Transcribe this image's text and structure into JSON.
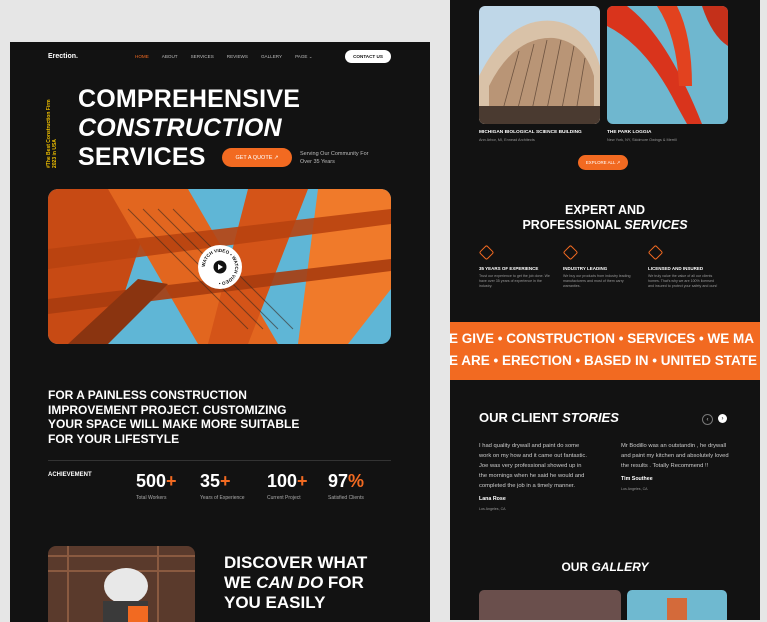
{
  "left": {
    "logo": "Erection.",
    "nav": [
      "HOME",
      "ABOUT",
      "SERVICES",
      "REVIEWS",
      "GALLERY",
      "PAGE ⌄"
    ],
    "contact": "CONTACT US",
    "vertical": "#The Best Construction Firm 2023 in USA",
    "hero": {
      "line1": "COMPREHENSIVE",
      "line2": "CONSTRUCTION",
      "line3": "SERVICES"
    },
    "quote_btn": "GET A QUOTE ↗",
    "serving": "Serving Our Community For Over 35 Years",
    "watch_video": "WATCH VIDEO • WATCH VIDEO •",
    "paragraph": "FOR A PAINLESS CONSTRUCTION IMPROVEMENT PROJECT. CUSTOMIZING YOUR SPACE WILL MAKE MORE SUITABLE FOR YOUR LIFESTYLE",
    "achievement": "ACHIEVEMENT",
    "stats": [
      {
        "num": "500",
        "plus": "+",
        "label": "Total Workers"
      },
      {
        "num": "35",
        "plus": "+",
        "label": "Years of Experience"
      },
      {
        "num": "100",
        "plus": "+",
        "label": "Current Project"
      },
      {
        "num": "97",
        "plus": "%",
        "label": "Satisfied Clients"
      }
    ],
    "discover": {
      "a": "DISCOVER WHAT",
      "b": "WE ",
      "c": "CAN DO",
      "d": " FOR",
      "e": "YOU EASILY"
    }
  },
  "right": {
    "projects": [
      {
        "title": "MICHIGAN BIOLOGICAL SCIENCE BUILDING",
        "sub": "Ann Arbor, MI, Ennead Architects"
      },
      {
        "title": "THE PARK LOGGIA",
        "sub": "New York, NY, Skidmore Owings & Merrill"
      }
    ],
    "explore": "EXPLORE ALL ↗",
    "expert": {
      "l1": "EXPERT AND",
      "l2": "PROFESSIONAL ",
      "l2i": "SERVICES"
    },
    "features": [
      {
        "title": "35 YEARS OF EXPERIENCE",
        "desc": "Trust our experience to get the job done. We have over 35 years of experience in the industry."
      },
      {
        "title": "INDUSTRY LEADING",
        "desc": "We buy our products from industry leading manufacturers and most of them carry warranties."
      },
      {
        "title": "LICENSED AND INSURED",
        "desc": "We truly value the value of all our clients homes. That's why we are 100% licensed and insured to protect your safety and ours!"
      }
    ],
    "band1": "E GIVE • CONSTRUCTION • SERVICES • WE MA",
    "band2": "E ARE • ERECTION • BASED IN • UNITED STATE",
    "stories": {
      "a": "OUR CLIENT ",
      "b": "STORIES"
    },
    "reviews": [
      {
        "text": "I had quality drywall and paint do some work on my how and it came out fantastic. Joe was very professional showed up in the mornings when he said he would and completed the job in a timely manner.",
        "name": "Lana Rose",
        "loc": "Los Angeles, CA"
      },
      {
        "text": "Mr Bodillo was an outstandin , he drywall and paint my kitchen and absolutely loved the results . Totally Recommend !!",
        "name": "Tim Southee",
        "loc": "Los Angeles, CA"
      }
    ],
    "gallery": {
      "a": "OUR ",
      "b": "GALLERY"
    }
  },
  "colors": {
    "accent": "#f26a21",
    "bg": "#121212",
    "yellow": "#f2c200"
  }
}
